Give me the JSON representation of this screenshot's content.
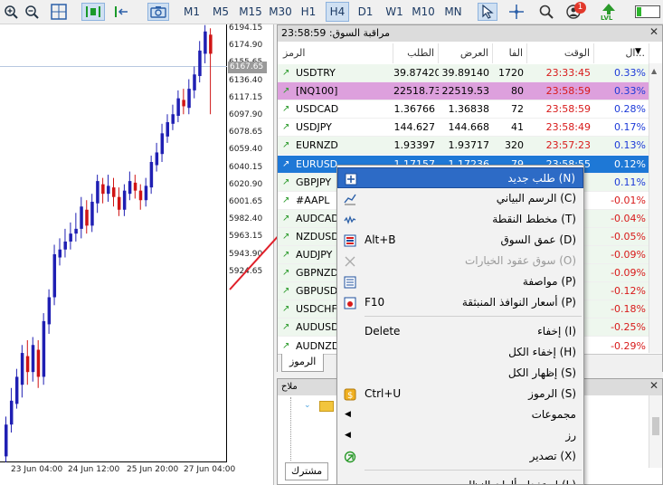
{
  "toolbar": {
    "timeframes": [
      "M1",
      "M5",
      "M15",
      "M30",
      "H1",
      "H4",
      "D1",
      "W1",
      "M10",
      "MN"
    ],
    "active_timeframe": "H4",
    "notifications_count": "1",
    "lvl_label": "LVL"
  },
  "chart": {
    "price_labels": [
      "6194.15",
      "6174.90",
      "6155.65",
      "6136.40",
      "6117.15",
      "6097.90",
      "6078.65",
      "6059.40",
      "6040.15",
      "6020.90",
      "6001.65",
      "5982.40",
      "5963.15",
      "5943.90",
      "5924.65"
    ],
    "current_price": "6167.65",
    "time_labels": [
      "23 Jun 04:00",
      "24 Jun 12:00",
      "25 Jun 20:00",
      "27 Jun 04:00"
    ],
    "up_color": "#1f1fb3",
    "down_color": "#d01414"
  },
  "market_watch": {
    "title": "مراقبة السوق: 23:58:59",
    "columns": {
      "symbol": "الرمز",
      "bid": "الطلب",
      "ask": "العرض",
      "spread": "الفا",
      "time": "الوقت",
      "change": "ال..."
    },
    "rows": [
      {
        "symbol": "USDTRY",
        "bid": "39.87420",
        "ask": "39.89140",
        "spread": "1720",
        "time": "23:33:45",
        "change": "0.33%",
        "dir": "up",
        "style": "green"
      },
      {
        "symbol": "[NQ100]",
        "bid": "22518.73",
        "ask": "22519.53",
        "spread": "80",
        "time": "23:58:59",
        "change": "0.33%",
        "dir": "up",
        "style": "purple"
      },
      {
        "symbol": "USDCAD",
        "bid": "1.36766",
        "ask": "1.36838",
        "spread": "72",
        "time": "23:58:59",
        "change": "0.28%",
        "dir": "up",
        "style": "white"
      },
      {
        "symbol": "USDJPY",
        "bid": "144.627",
        "ask": "144.668",
        "spread": "41",
        "time": "23:58:49",
        "change": "0.17%",
        "dir": "up",
        "style": "white"
      },
      {
        "symbol": "EURNZD",
        "bid": "1.93397",
        "ask": "1.93717",
        "spread": "320",
        "time": "23:57:23",
        "change": "0.13%",
        "dir": "up",
        "style": "green"
      },
      {
        "symbol": "EURUSD",
        "bid": "1.17157",
        "ask": "1.17236",
        "spread": "79",
        "time": "23:58:55",
        "change": "0.12%",
        "dir": "up",
        "style": "selected"
      },
      {
        "symbol": "GBPJPY",
        "bid": "",
        "ask": "",
        "spread": "",
        "time": "",
        "change": "0.11%",
        "dir": "up",
        "style": "green"
      },
      {
        "symbol": "#AAPL",
        "bid": "",
        "ask": "",
        "spread": "",
        "time": "",
        "change": "-0.01%",
        "dir": "up",
        "style": "white"
      },
      {
        "symbol": "AUDCAD",
        "bid": "",
        "ask": "",
        "spread": "",
        "time": "",
        "change": "-0.04%",
        "dir": "up",
        "style": "green"
      },
      {
        "symbol": "NZDUSD",
        "bid": "",
        "ask": "",
        "spread": "",
        "time": "",
        "change": "-0.05%",
        "dir": "up",
        "style": "green"
      },
      {
        "symbol": "AUDJPY",
        "bid": "",
        "ask": "",
        "spread": "",
        "time": "",
        "change": "-0.09%",
        "dir": "up",
        "style": "green"
      },
      {
        "symbol": "GBPNZD",
        "bid": "",
        "ask": "",
        "spread": "",
        "time": "",
        "change": "-0.09%",
        "dir": "up",
        "style": "green"
      },
      {
        "symbol": "GBPUSD",
        "bid": "",
        "ask": "",
        "spread": "",
        "time": "",
        "change": "-0.12%",
        "dir": "up",
        "style": "green"
      },
      {
        "symbol": "USDCHF",
        "bid": "",
        "ask": "",
        "spread": "",
        "time": "",
        "change": "-0.18%",
        "dir": "up",
        "style": "green"
      },
      {
        "symbol": "AUDUSD",
        "bid": "",
        "ask": "",
        "spread": "",
        "time": "",
        "change": "-0.25%",
        "dir": "up",
        "style": "green"
      },
      {
        "symbol": "AUDNZD",
        "bid": "",
        "ask": "",
        "spread": "",
        "time": "",
        "change": "-0.29%",
        "dir": "up",
        "style": "white"
      }
    ],
    "tab_label": "الرموز"
  },
  "navigator": {
    "title": "ملاح",
    "tab_label": "مشترك"
  },
  "context_menu": {
    "items": [
      {
        "label": "طلب جديد (N)",
        "shortcut": "",
        "icon": "new-order-icon",
        "state": "highlighted"
      },
      {
        "label": "الرسم البياني (C)",
        "shortcut": "",
        "icon": "chart-icon",
        "state": "normal"
      },
      {
        "label": "مخطط النقطة (T)",
        "shortcut": "",
        "icon": "tick-chart-icon",
        "state": "normal"
      },
      {
        "label": "عمق السوق (D)",
        "shortcut": "Alt+B",
        "icon": "depth-icon",
        "state": "normal"
      },
      {
        "label": "سوق عقود الخيارات (O)",
        "shortcut": "",
        "icon": "options-icon",
        "state": "disabled"
      },
      {
        "label": "مواصفة (P)",
        "shortcut": "",
        "icon": "spec-icon",
        "state": "normal"
      },
      {
        "label": "أسعار النوافذ المنبثقة (P)",
        "shortcut": "F10",
        "icon": "popup-prices-icon",
        "state": "normal"
      },
      {
        "label": "إخفاء (I)",
        "shortcut": "Delete",
        "icon": "",
        "state": "normal"
      },
      {
        "label": "إخفاء الكل (H)",
        "shortcut": "",
        "icon": "",
        "state": "normal"
      },
      {
        "label": "إظهار الكل (S)",
        "shortcut": "",
        "icon": "",
        "state": "normal"
      },
      {
        "label": "الرموز (S)",
        "shortcut": "Ctrl+U",
        "icon": "symbols-icon",
        "state": "normal"
      },
      {
        "label": "مجموعات",
        "shortcut": "",
        "icon": "",
        "state": "submenu"
      },
      {
        "label": "رز",
        "shortcut": "",
        "icon": "",
        "state": "submenu"
      },
      {
        "label": "تصدير (X)",
        "shortcut": "",
        "icon": "export-icon",
        "state": "normal"
      },
      {
        "label": "استخدام ألوان النظام (L)",
        "shortcut": "",
        "icon": "",
        "state": "normal"
      }
    ]
  }
}
